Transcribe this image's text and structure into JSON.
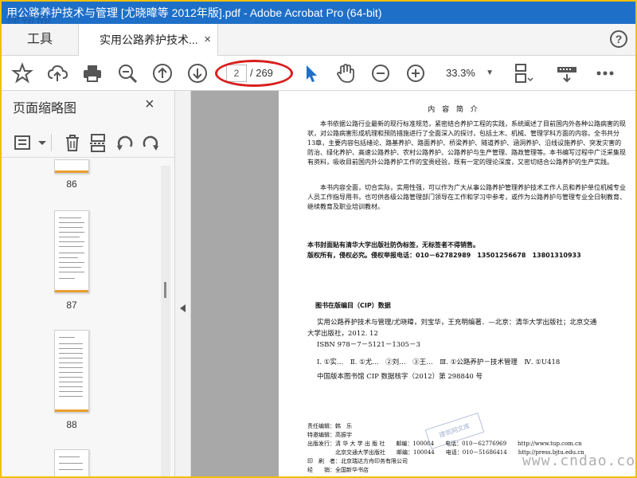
{
  "window": {
    "title": "用公路养护技术与管理 [尤晓暐等 2012年版].pdf - Adobe Acrobat Pro (64-bit)"
  },
  "watermark_logo": "建筑网",
  "watermark_site": "www.cndao.com",
  "tabs": {
    "tools": "工具",
    "document": "实用公路养护技术...",
    "close": "×",
    "help": "?"
  },
  "toolbar": {
    "icons": [
      "star-icon",
      "cloud-upload-icon",
      "print-icon",
      "zoom-search-icon",
      "page-up-icon",
      "page-down-icon",
      "select-arrow-icon",
      "hand-icon",
      "zoom-out-icon",
      "zoom-in-icon",
      "fit-page-icon",
      "scroll-mode-icon",
      "keyboard-icon"
    ],
    "page_current": "2",
    "page_total": "/ 269",
    "zoom": "33.3%"
  },
  "sidebar": {
    "title": "页面缩略图",
    "close": "×",
    "thumbnails": [
      {
        "page": "86"
      },
      {
        "page": "87"
      },
      {
        "page": "88"
      }
    ]
  },
  "pdf": {
    "heading": "内 容 简 介",
    "intro_1": "本书依据公路行业最新的现行标准规范，紧密结合养护工程的实践，系统阐述了目前国内外各种公路病害的现状，对公路病害形成机理和预防措施进行了全面深入的探讨，包括土木、机械、管理学科方面的内容。全书共分13章，主要内容包括绪论、路基养护、路面养护、桥梁养护、隧道养护、涵洞养护、沿线设施养护、突发灾害的防治、绿化养护、高速公路养护、农村公路养护、公路养护与生产管理、路政管理等。本书编写过程中广泛采集现有资料，吸收目前国内外公路养护工作的宝贵经验，既有一定的理论深度，又密切结合公路养护的生产实践。",
    "intro_2": "本书内容全面，切合实际，实用性强，可以作为广大从事公路养护管理养护技术工作人员和养护单位机械专业人员工作指导用书，也可供各级公路管理部门领导在工作和学习中参考，或作为公路养护与管理专业全日制教育、继续教育及职业培训教材。",
    "anti_fake": "本书封面贴有清华大学出版社防伪标签，无标签者不得销售。",
    "rights": "版权所有，侵权必究。侵权举报电话：010－62782989　13501256678　13801310933",
    "cip_title": "图书在版编目（CIP）数据",
    "cip_line1": "实用公路养护技术与管理/尤晓暐，刘宝华，王充明编著．—北京：清华大学出版社；北京交通",
    "cip_line2": "大学出版社，2012. 12",
    "cip_isbn": "ISBN 978－7－5121－1305－3",
    "cip_class": "Ⅰ. ①实…　Ⅱ. ①尤…　②刘…　③王…　Ⅲ. ①公路养护－技术管理　Ⅳ. ①U418",
    "cip_record": "中国版本图书馆 CIP 数据核字（2012）第 298840 号",
    "editor": "责任编辑：韩　乐",
    "special_editor": "特邀编辑：高振宇",
    "publisher1": "出版发行：清 华 大 学 出 版 社　　邮编：100084　　电话：010－62776969　　http://www.tup.com.cn",
    "publisher2": "　　　　　北京交通大学出版社　　邮编：100044　　电话：010－51686414　　http://press.bjtu.edu.cn",
    "printer": "印　刷　者：北京瑞达方舟印务有限公司",
    "distributor": "经　　销：全国新华书店",
    "stamp": "建筑网文库"
  },
  "colors": {
    "titlebar": "#1e6fc8",
    "highlight_ring": "#d81e1e",
    "frame": "#f0c000"
  }
}
